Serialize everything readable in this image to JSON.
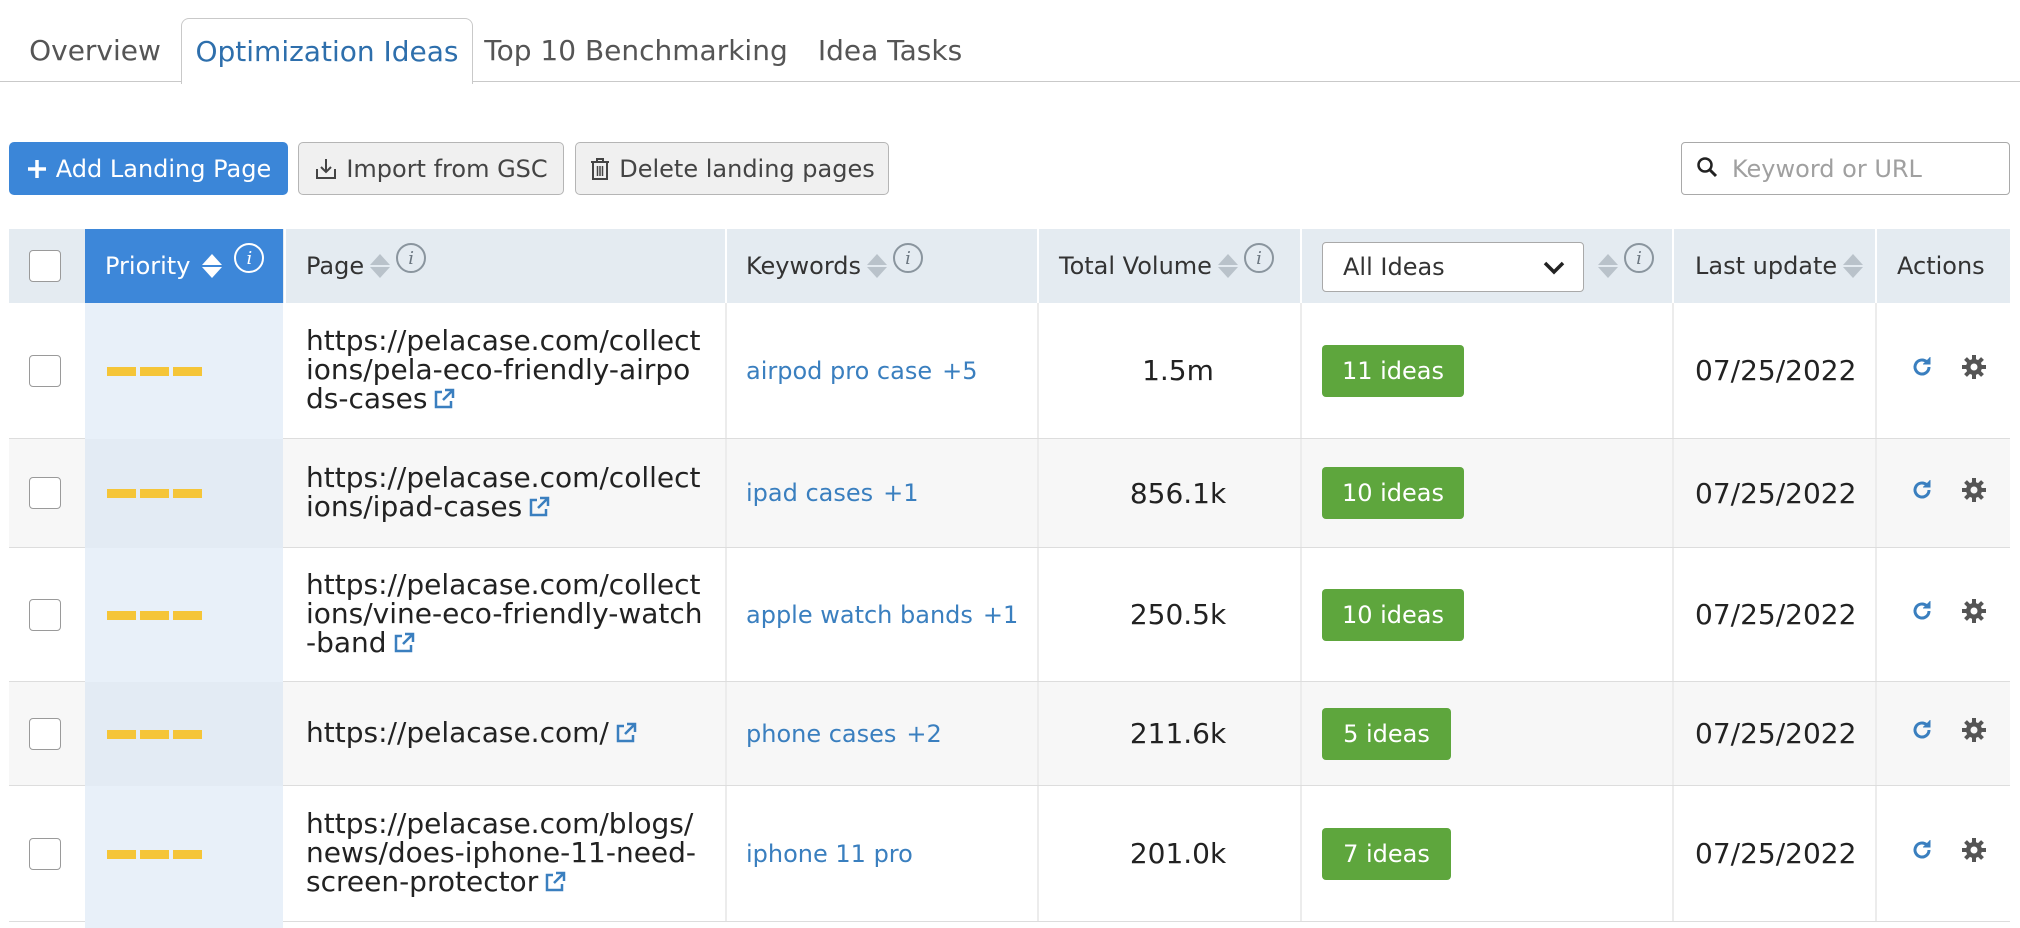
{
  "tabs": [
    {
      "label": "Overview"
    },
    {
      "label": "Optimization Ideas",
      "active": true
    },
    {
      "label": "Top 10 Benchmarking"
    },
    {
      "label": "Idea Tasks"
    }
  ],
  "toolbar": {
    "add_label": "Add Landing Page",
    "import_label": "Import from GSC",
    "delete_label": "Delete landing pages",
    "search_placeholder": "Keyword or URL"
  },
  "table": {
    "headers": {
      "priority": "Priority",
      "page": "Page",
      "keywords": "Keywords",
      "total_volume": "Total Volume",
      "ideas_filter": "All Ideas",
      "last_update": "Last update",
      "actions": "Actions"
    },
    "rows": [
      {
        "page": "https://pelacase.com/collections/pela-eco-friendly-airpods-cases",
        "keyword": "airpod pro case",
        "more": "+5",
        "volume": "1.5m",
        "ideas": "11 ideas",
        "date": "07/25/2022"
      },
      {
        "page": "https://pelacase.com/collections/ipad-cases",
        "keyword": "ipad cases",
        "more": "+1",
        "volume": "856.1k",
        "ideas": "10 ideas",
        "date": "07/25/2022"
      },
      {
        "page": "https://pelacase.com/collections/vine-eco-friendly-watch-band",
        "keyword": "apple watch bands",
        "more": "+1",
        "volume": "250.5k",
        "ideas": "10 ideas",
        "date": "07/25/2022"
      },
      {
        "page": "https://pelacase.com/",
        "keyword": "phone cases",
        "more": "+2",
        "volume": "211.6k",
        "ideas": "5 ideas",
        "date": "07/25/2022"
      },
      {
        "page": "https://pelacase.com/blogs/news/does-iphone-11-need-screen-protector",
        "keyword": "iphone 11 pro",
        "more": "",
        "volume": "201.0k",
        "ideas": "7 ideas",
        "date": "07/25/2022"
      }
    ]
  },
  "colors": {
    "accent": "#3b86d8",
    "ideas_badge": "#5ea63d",
    "priority_bar": "#f5c538",
    "link": "#3a7fbf"
  }
}
